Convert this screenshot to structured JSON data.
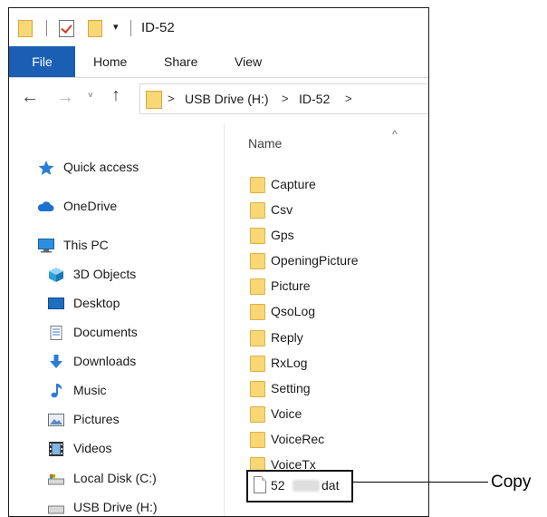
{
  "window": {
    "title": "ID-52",
    "quick_access_dropdown": "▾"
  },
  "ribbon": {
    "tabs": [
      "File",
      "Home",
      "Share",
      "View"
    ]
  },
  "address": {
    "back": "←",
    "forward": "→",
    "recent": "˅",
    "up": "↑",
    "crumbs": [
      "USB Drive (H:)",
      "ID-52"
    ],
    "chevron": ">"
  },
  "nav": {
    "items": [
      {
        "label": "Quick access",
        "icon": "star-icon"
      },
      {
        "label": "OneDrive",
        "icon": "cloud-icon"
      },
      {
        "label": "This PC",
        "icon": "monitor-icon"
      },
      {
        "label": "3D Objects",
        "icon": "cube-icon"
      },
      {
        "label": "Desktop",
        "icon": "desktop-icon"
      },
      {
        "label": "Documents",
        "icon": "document-icon"
      },
      {
        "label": "Downloads",
        "icon": "download-icon"
      },
      {
        "label": "Music",
        "icon": "music-note-icon"
      },
      {
        "label": "Pictures",
        "icon": "picture-icon"
      },
      {
        "label": "Videos",
        "icon": "film-icon"
      },
      {
        "label": "Local Disk (C:)",
        "icon": "disk-icon"
      },
      {
        "label": "USB Drive (H:)",
        "icon": "usb-drive-icon"
      }
    ]
  },
  "files": {
    "column_header": "Name",
    "sort_indicator": "^",
    "folders": [
      "Capture",
      "Csv",
      "Gps",
      "OpeningPicture",
      "Picture",
      "QsoLog",
      "Reply",
      "RxLog",
      "Setting",
      "Voice",
      "VoiceRec",
      "VoiceTx"
    ],
    "highlighted_file": {
      "prefix": "52",
      "suffix": "dat"
    }
  },
  "annotation": {
    "label": "Copy"
  },
  "colors": {
    "file_tab": "#1a5fb4",
    "folder": "#f8d775",
    "onedrive": "#1f6fd1"
  }
}
